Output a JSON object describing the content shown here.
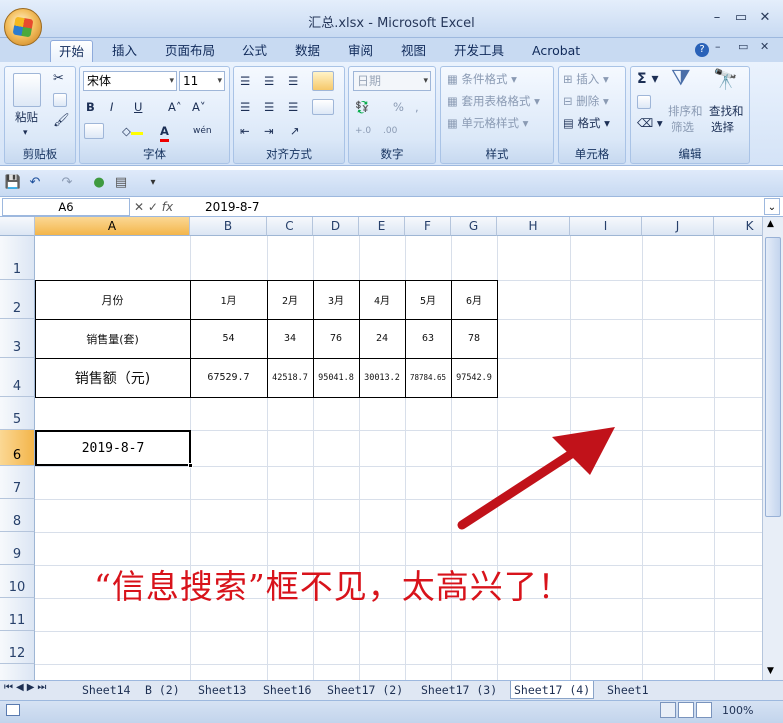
{
  "window": {
    "title": "汇总.xlsx - Microsoft Excel"
  },
  "ribbon": {
    "tabs": [
      "开始",
      "插入",
      "页面布局",
      "公式",
      "数据",
      "审阅",
      "视图",
      "开发工具",
      "Acrobat"
    ],
    "active_tab": "开始",
    "groups": {
      "clipboard": {
        "label": "剪贴板",
        "paste": "粘贴"
      },
      "font": {
        "label": "字体",
        "font_name": "宋体",
        "font_size": "11"
      },
      "alignment": {
        "label": "对齐方式"
      },
      "number": {
        "label": "数字",
        "format": "日期",
        "percent": "%"
      },
      "styles": {
        "label": "样式",
        "items": [
          "条件格式",
          "套用表格格式",
          "单元格样式"
        ]
      },
      "cells": {
        "label": "单元格",
        "items": [
          "插入",
          "删除",
          "格式"
        ]
      },
      "editing": {
        "label": "编辑",
        "sort_filter": "排序和",
        "sort_filter2": "筛选",
        "find_select": "查找和",
        "find_select2": "选择"
      }
    }
  },
  "formula_bar": {
    "name_box": "A6",
    "value": "2019-8-7"
  },
  "columns": [
    "A",
    "B",
    "C",
    "D",
    "E",
    "F",
    "G",
    "H",
    "I",
    "J",
    "K"
  ],
  "rows": [
    "1",
    "2",
    "3",
    "4",
    "5",
    "6",
    "7",
    "8",
    "9",
    "10",
    "11",
    "12"
  ],
  "table": {
    "row_labels": [
      "月份",
      "销售量(套)",
      "销售额（元)"
    ],
    "months": [
      "1月",
      "2月",
      "3月",
      "4月",
      "5月",
      "6月"
    ],
    "sales_qty": [
      "54",
      "34",
      "76",
      "24",
      "63",
      "78"
    ],
    "sales_amount": [
      "67529.7",
      "42518.7",
      "95041.8",
      "30013.2",
      "78784.65",
      "97542.9"
    ]
  },
  "active_cell": {
    "ref": "A6",
    "value": "2019-8-7"
  },
  "annotation": {
    "text": "“信息搜索”框不见，太高兴了！",
    "color": "#d8131b"
  },
  "sheet_tabs": [
    "Sheet14",
    "B (2)",
    "Sheet13",
    "Sheet16",
    "Sheet17 (2)",
    "Sheet17 (3)",
    "Sheet17 (4)",
    "Sheet1"
  ],
  "active_sheet": "Sheet17 (4)",
  "status": {
    "zoom": "100%"
  }
}
